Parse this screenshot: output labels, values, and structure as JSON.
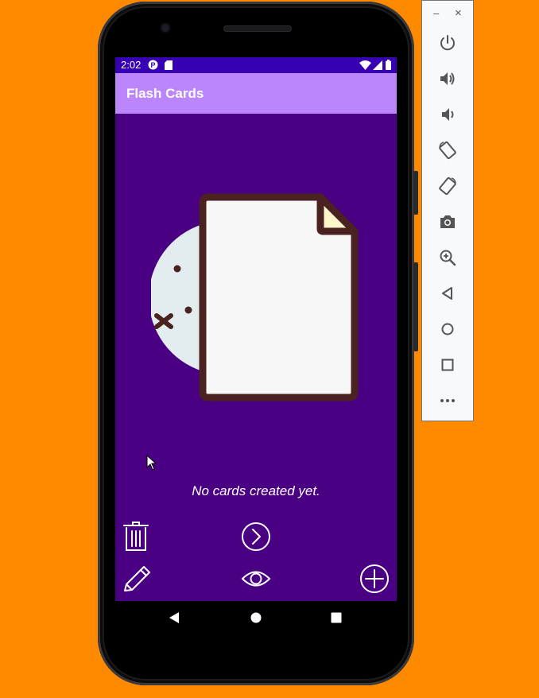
{
  "statusbar": {
    "time": "2:02"
  },
  "app": {
    "title": "Flash Cards",
    "empty_message": "No cards created yet."
  },
  "actions": {
    "delete": "trash-icon",
    "next": "next-icon",
    "edit": "pencil-icon",
    "view": "eye-icon",
    "add": "add-icon"
  },
  "emulator": {
    "minimize": "–",
    "close": "×",
    "tools": [
      "power",
      "volume-up",
      "volume-down",
      "rotate-left",
      "rotate-right",
      "screenshot",
      "zoom",
      "back",
      "home",
      "overview",
      "more"
    ]
  },
  "colors": {
    "background": "#FF8A00",
    "screen": "#4A0082",
    "statusbar": "#3700B3",
    "appbar": "#BB86FC",
    "illustration_outline": "#4A2320"
  }
}
